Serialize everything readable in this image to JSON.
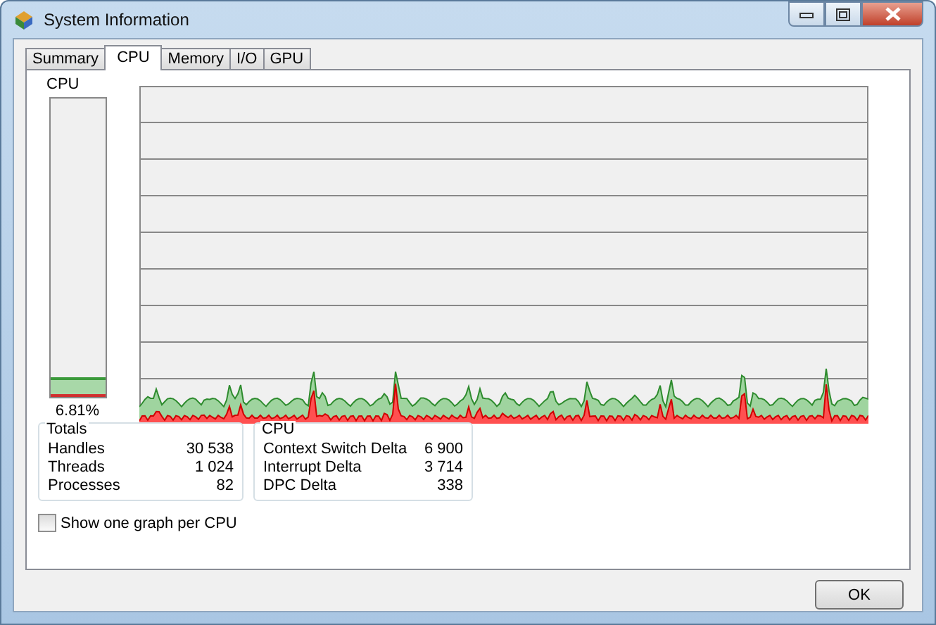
{
  "window": {
    "title": "System Information"
  },
  "tabs": [
    {
      "label": "Summary",
      "selected": false
    },
    {
      "label": "CPU",
      "selected": true
    },
    {
      "label": "Memory",
      "selected": false
    },
    {
      "label": "I/O",
      "selected": false
    },
    {
      "label": "GPU",
      "selected": false
    }
  ],
  "cpu_meter": {
    "label": "CPU",
    "level": 0.0681,
    "reading": "6.81%"
  },
  "totals": {
    "title": "Totals",
    "rows": [
      {
        "label": "Handles",
        "value": "30 538"
      },
      {
        "label": "Threads",
        "value": "1 024"
      },
      {
        "label": "Processes",
        "value": "82"
      }
    ]
  },
  "cpu": {
    "title": "CPU",
    "rows": [
      {
        "label": "Context Switch Delta",
        "value": "6 900"
      },
      {
        "label": "Interrupt Delta",
        "value": "3 714"
      },
      {
        "label": "DPC Delta",
        "value": "338"
      }
    ]
  },
  "per_cpu_checkbox": {
    "label": "Show one graph per CPU",
    "checked": false
  },
  "buttons": [
    "OK"
  ]
}
